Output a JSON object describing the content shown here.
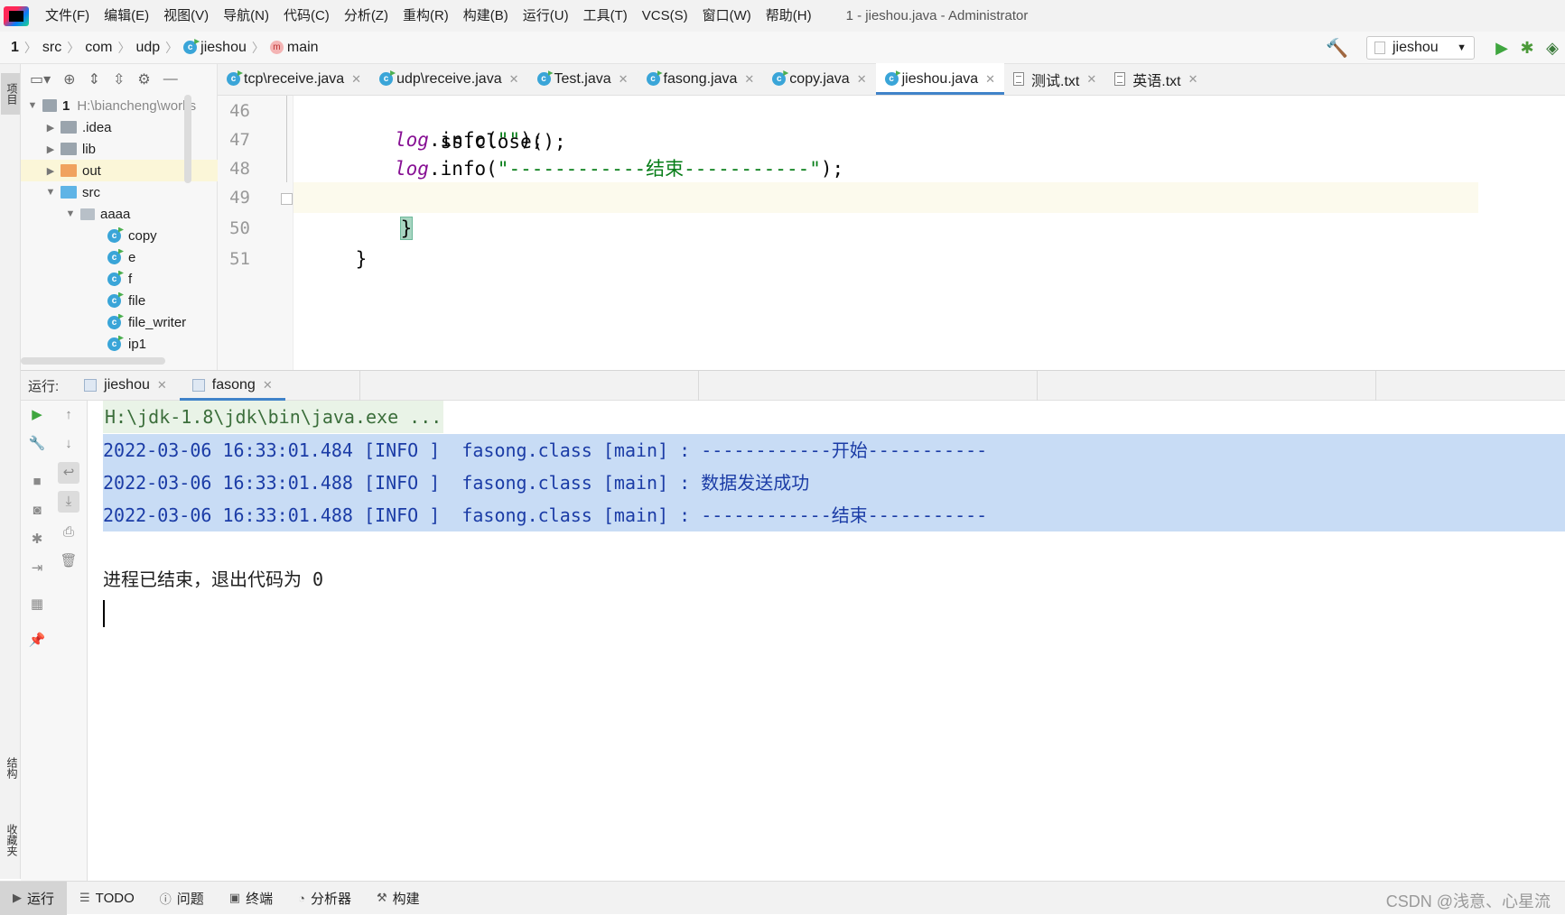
{
  "menu": {
    "items": [
      "文件(F)",
      "编辑(E)",
      "视图(V)",
      "导航(N)",
      "代码(C)",
      "分析(Z)",
      "重构(R)",
      "构建(B)",
      "运行(U)",
      "工具(T)",
      "VCS(S)",
      "窗口(W)",
      "帮助(H)"
    ],
    "window_title": "1 - jieshou.java - Administrator"
  },
  "breadcrumb": {
    "project": "1",
    "items": [
      "src",
      "com",
      "udp",
      "jieshou",
      "main"
    ]
  },
  "run_config": {
    "selected": "jieshou"
  },
  "left_strip": {
    "project_tab": "项目",
    "structure_tab": "结构",
    "favorites_tab": "收藏夹"
  },
  "project_tree": {
    "root_name": "1",
    "root_path": "H:\\biancheng\\works",
    "rows": [
      ".idea",
      "lib",
      "out",
      "src",
      "aaaa",
      "copy",
      "e",
      "f",
      "file",
      "file_writer",
      "ip1"
    ]
  },
  "editor_tabs": [
    "tcp\\receive.java",
    "udp\\receive.java",
    "Test.java",
    "fasong.java",
    "copy.java",
    "jieshou.java",
    "测试.txt",
    "英语.txt"
  ],
  "editor": {
    "line_numbers": [
      "46",
      "47",
      "48",
      "49",
      "50",
      "51"
    ],
    "line46": "ss.close();",
    "line47_obj": "log",
    "line47_call": ".info(",
    "line47_str": "\"\"",
    "line47_end": ");",
    "line48_obj": "log",
    "line48_call": ".info(",
    "line48_str": "\"------------结束-----------\"",
    "line48_end": ");",
    "line49": "}",
    "line50": "}"
  },
  "run_panel": {
    "label": "运行:",
    "tabs": [
      "jieshou",
      "fasong"
    ],
    "console": {
      "command": "H:\\jdk-1.8\\jdk\\bin\\java.exe ...",
      "info_lines": [
        "2022-03-06 16:33:01.484 [INFO ]  fasong.class [main] : ------------开始-----------",
        "2022-03-06 16:33:01.488 [INFO ]  fasong.class [main] : 数据发送成功",
        "2022-03-06 16:33:01.488 [INFO ]  fasong.class [main] : ------------结束-----------"
      ],
      "exit_message": "进程已结束，退出代码为 0"
    }
  },
  "bottom_bar": {
    "items": [
      "运行",
      "TODO",
      "问题",
      "终端",
      "分析器",
      "构建"
    ],
    "watermark": "CSDN @浅意、心星流"
  },
  "colors": {
    "accent": "#4083c9",
    "run_green": "#3fa63f",
    "string_green": "#067d17",
    "log_purple": "#871094",
    "console_info_blue": "#1b3ca6",
    "selection": "#c8dcf5"
  }
}
